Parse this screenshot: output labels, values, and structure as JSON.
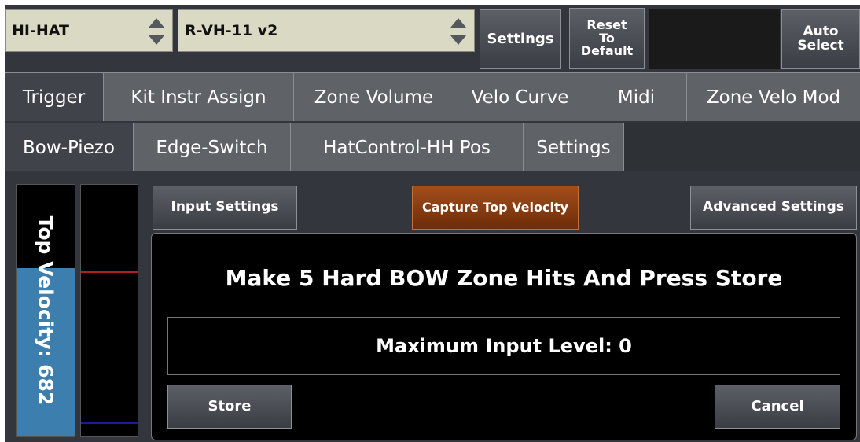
{
  "top_bar": {
    "instrument_select": "HI-HAT",
    "model_select": "R-VH-11 v2",
    "settings_button": "Settings",
    "reset_button_lines": [
      "Reset",
      "To",
      "Default"
    ],
    "auto_select_lines": [
      "Auto",
      "Select"
    ]
  },
  "main_tabs": [
    {
      "label": "Trigger",
      "active": true
    },
    {
      "label": "Kit Instr Assign",
      "active": false
    },
    {
      "label": "Zone Volume",
      "active": false
    },
    {
      "label": "Velo Curve",
      "active": false
    },
    {
      "label": "Midi",
      "active": false
    },
    {
      "label": "Zone Velo Mod",
      "active": false
    }
  ],
  "sub_tabs": [
    {
      "label": "Bow-Piezo",
      "active": true
    },
    {
      "label": "Edge-Switch",
      "active": false
    },
    {
      "label": "HatControl-HH Pos",
      "active": false
    },
    {
      "label": "Settings",
      "active": false
    }
  ],
  "velocity_meter": {
    "label": "Top Velocity: 682",
    "fill_fraction": 0.67,
    "red_marker_fraction": 0.66,
    "blue_marker_fraction": 0.06
  },
  "actions": {
    "input_settings": "Input Settings",
    "capture_top_velocity": "Capture Top Velocity",
    "advanced_settings": "Advanced Settings"
  },
  "capture_panel": {
    "instruction": "Make 5 Hard BOW Zone Hits And Press Store",
    "level_text": "Maximum Input Level: 0",
    "store_button": "Store",
    "cancel_button": "Cancel"
  },
  "colors": {
    "accent_active": "#8a3d12",
    "meter_fill": "#3c7fae",
    "red_marker": "#b02020",
    "blue_marker": "#1a1aa0"
  }
}
